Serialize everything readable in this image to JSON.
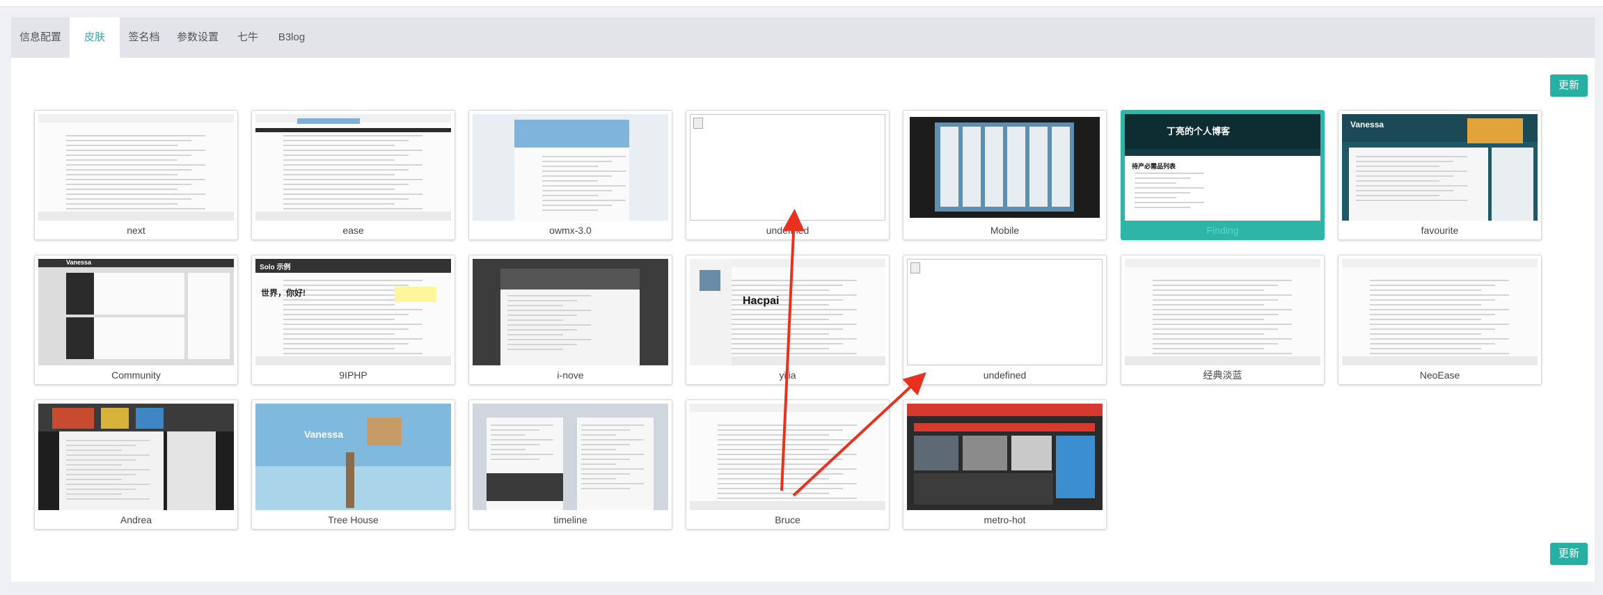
{
  "tabs": [
    {
      "label": "信息配置",
      "active": false
    },
    {
      "label": "皮肤",
      "active": true
    },
    {
      "label": "签名档",
      "active": false
    },
    {
      "label": "参数设置",
      "active": false
    },
    {
      "label": "七牛",
      "active": false
    },
    {
      "label": "B3log",
      "active": false
    }
  ],
  "update_button_label": "更新",
  "skins": [
    {
      "name": "next",
      "style": "white",
      "selected": false
    },
    {
      "name": "ease",
      "style": "white",
      "selected": false
    },
    {
      "name": "owmx-3.0",
      "style": "blue",
      "selected": false
    },
    {
      "name": "undefined",
      "style": "broken",
      "selected": false
    },
    {
      "name": "Mobile",
      "style": "phone",
      "selected": false
    },
    {
      "name": "Finding",
      "style": "teal",
      "selected": true
    },
    {
      "name": "favourite",
      "style": "teal-dark",
      "selected": false
    },
    {
      "name": "Community",
      "style": "dark-white",
      "selected": false
    },
    {
      "name": "9IPHP",
      "style": "white",
      "selected": false
    },
    {
      "name": "i-nove",
      "style": "gray",
      "selected": false
    },
    {
      "name": "yilia",
      "style": "white",
      "selected": false
    },
    {
      "name": "undefined",
      "style": "broken",
      "selected": false
    },
    {
      "name": "经典淡蓝",
      "style": "white",
      "selected": false
    },
    {
      "name": "NeoEase",
      "style": "white",
      "selected": false
    },
    {
      "name": "Andrea",
      "style": "dark",
      "selected": false
    },
    {
      "name": "Tree House",
      "style": "sky",
      "selected": false
    },
    {
      "name": "timeline",
      "style": "gray-blue",
      "selected": false
    },
    {
      "name": "Bruce",
      "style": "white",
      "selected": false
    },
    {
      "name": "metro-hot",
      "style": "metro",
      "selected": false
    }
  ],
  "thumb_text": {
    "finding_title": "丁亮的个人博客",
    "finding_heading": "待产必需品列表",
    "vanessa": "Vanessa",
    "hacpai": "Hacpai",
    "solo": "Solo 示例",
    "hello": "世界，你好!",
    "treehouse": "Vanessa"
  },
  "annotation_color": "#e8321e"
}
